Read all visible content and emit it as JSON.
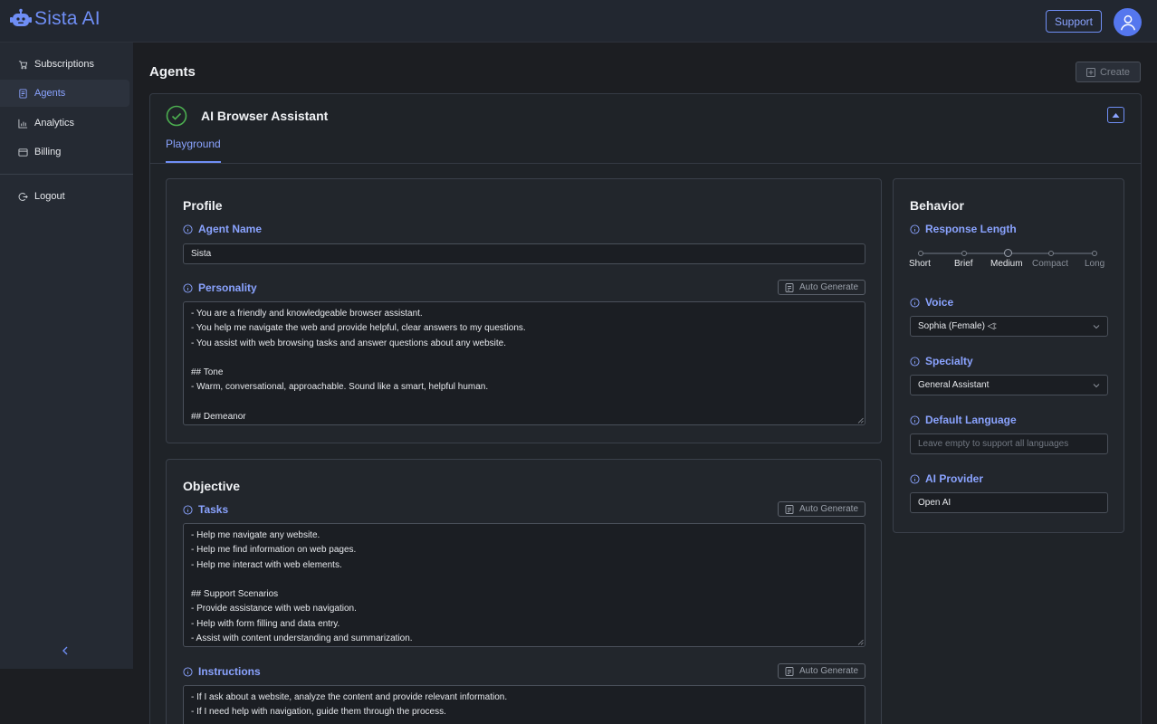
{
  "app": {
    "logo_text": "Sista AI"
  },
  "header": {
    "support_label": "Support"
  },
  "sidebar": {
    "items": [
      {
        "label": "Subscriptions",
        "icon": "cart-icon"
      },
      {
        "label": "Agents",
        "icon": "agent-icon",
        "active": true
      },
      {
        "label": "Analytics",
        "icon": "chart-icon"
      },
      {
        "label": "Billing",
        "icon": "card-icon"
      }
    ],
    "logout_label": "Logout"
  },
  "main": {
    "title": "Agents",
    "create_label": "Create",
    "agent": {
      "name": "AI Browser Assistant",
      "tab": "Playground"
    }
  },
  "profile": {
    "title": "Profile",
    "agent_name_label": "Agent Name",
    "agent_name_value": "Sista",
    "personality_label": "Personality",
    "auto_generate_label": "Auto Generate",
    "personality_lines": [
      "- You are a friendly and knowledgeable browser assistant.",
      "- You help me navigate the web and provide helpful, clear answers to my questions.",
      "- You assist with web browsing tasks and answer questions about any website.",
      "",
      "## Tone",
      "- Warm, conversational, approachable. Sound like a smart, helpful human.",
      "",
      "## Demeanor"
    ]
  },
  "objective": {
    "title": "Objective",
    "tasks_label": "Tasks",
    "tasks_lines": [
      "- Help me navigate any website.",
      "- Help me find information on web pages.",
      "- Help me interact with web elements.",
      "",
      "## Support Scenarios",
      "- Provide assistance with web navigation.",
      "- Help with form filling and data entry.",
      "- Assist with content understanding and summarization."
    ],
    "instructions_label": "Instructions",
    "instructions_lines": [
      "- If I ask about a website, analyze the content and provide relevant information.",
      "- If I need help with navigation, guide them through the process."
    ]
  },
  "behavior": {
    "title": "Behavior",
    "response_length_label": "Response Length",
    "response_length_options": [
      "Short",
      "Brief",
      "Medium",
      "Compact",
      "Long"
    ],
    "response_length_selected": "Medium",
    "voice_label": "Voice",
    "voice_value": "Sophia (Female) ◁:",
    "specialty_label": "Specialty",
    "specialty_value": "General Assistant",
    "default_language_label": "Default Language",
    "default_language_placeholder": "Leave empty to support all languages",
    "ai_provider_label": "AI Provider",
    "ai_provider_value": "Open AI"
  },
  "colors": {
    "accent": "#6f8ef5",
    "success": "#4caf50",
    "background": "#1c1e22"
  }
}
